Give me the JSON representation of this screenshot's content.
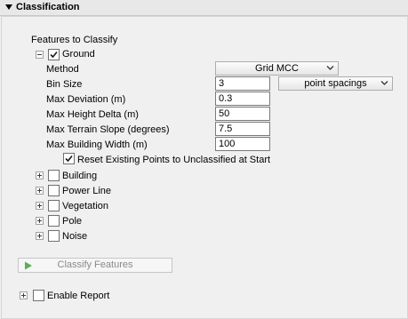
{
  "section": {
    "title": "Classification"
  },
  "features_heading": "Features to Classify",
  "ground": {
    "label": "Ground",
    "checked": true,
    "method_label": "Method",
    "method_value": "Grid MCC",
    "bin_size_label": "Bin Size",
    "bin_size_value": "3",
    "bin_size_unit": "point spacings",
    "max_deviation_label": "Max Deviation (m)",
    "max_deviation_value": "0.3",
    "max_height_delta_label": "Max Height Delta (m)",
    "max_height_delta_value": "50",
    "max_terrain_slope_label": "Max Terrain Slope (degrees)",
    "max_terrain_slope_value": "7.5",
    "max_building_width_label": "Max Building Width (m)",
    "max_building_width_value": "100",
    "reset_label": "Reset Existing Points to Unclassified at Start",
    "reset_checked": true
  },
  "other_features": [
    {
      "label": "Building",
      "checked": false
    },
    {
      "label": "Power Line",
      "checked": false
    },
    {
      "label": "Vegetation",
      "checked": false
    },
    {
      "label": "Pole",
      "checked": false
    },
    {
      "label": "Noise",
      "checked": false
    }
  ],
  "classify_button": "Classify Features",
  "enable_report": {
    "label": "Enable Report",
    "checked": false
  },
  "colors": {
    "check": "#1a1a1a",
    "header_bg": "#e8e8e8",
    "disabled_text": "#8a8a8a",
    "play_icon": "#58b058"
  }
}
